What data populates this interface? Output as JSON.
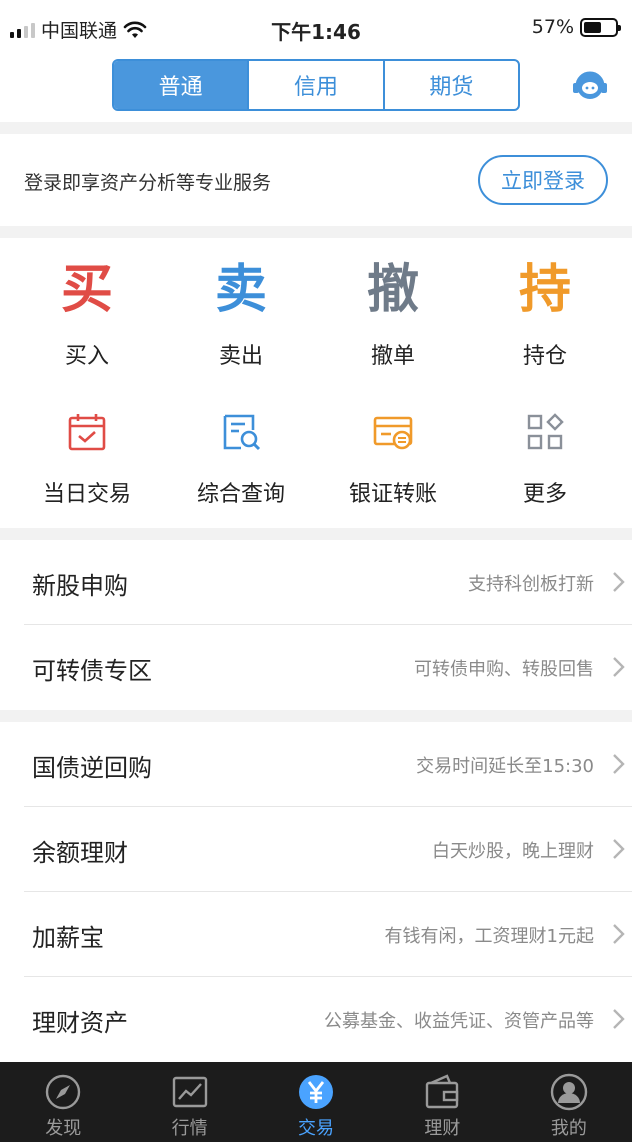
{
  "status": {
    "carrier": "中国联通",
    "time": "下午1:46",
    "battery": "57%"
  },
  "header": {
    "tabs": [
      "普通",
      "信用",
      "期货"
    ],
    "active_tab": 0,
    "cs_icon": "headset-icon"
  },
  "login": {
    "text": "登录即享资产分析等专业服务",
    "button": "立即登录"
  },
  "grid": {
    "row1": [
      {
        "glyph": "买",
        "label": "买入",
        "color": "#e04c46"
      },
      {
        "glyph": "卖",
        "label": "卖出",
        "color": "#3d8fd9"
      },
      {
        "glyph": "撤",
        "label": "撤单",
        "color": "#6f7b89"
      },
      {
        "glyph": "持",
        "label": "持仓",
        "color": "#f09a2a"
      }
    ],
    "row2": [
      {
        "icon": "calendar-check-icon",
        "label": "当日交易",
        "color": "#e04c46"
      },
      {
        "icon": "document-search-icon",
        "label": "综合查询",
        "color": "#3d8fd9"
      },
      {
        "icon": "bank-card-transfer-icon",
        "label": "银证转账",
        "color": "#f09a2a"
      },
      {
        "icon": "grid-more-icon",
        "label": "更多",
        "color": "#8a9099"
      }
    ]
  },
  "list1": [
    {
      "title": "新股申购",
      "sub": "支持科创板打新"
    },
    {
      "title": "可转债专区",
      "sub": "可转债申购、转股回售"
    }
  ],
  "list2": [
    {
      "title": "国债逆回购",
      "sub": "交易时间延长至15:30"
    },
    {
      "title": "余额理财",
      "sub": "白天炒股，晚上理财"
    },
    {
      "title": "加薪宝",
      "sub": "有钱有闲，工资理财1元起"
    },
    {
      "title": "理财资产",
      "sub": "公募基金、收益凭证、资管产品等"
    }
  ],
  "tabbar": [
    {
      "label": "发现",
      "icon": "compass-icon"
    },
    {
      "label": "行情",
      "icon": "chart-icon"
    },
    {
      "label": "交易",
      "icon": "yuan-icon"
    },
    {
      "label": "理财",
      "icon": "wallet-icon"
    },
    {
      "label": "我的",
      "icon": "user-icon"
    }
  ],
  "active_tab": 2
}
